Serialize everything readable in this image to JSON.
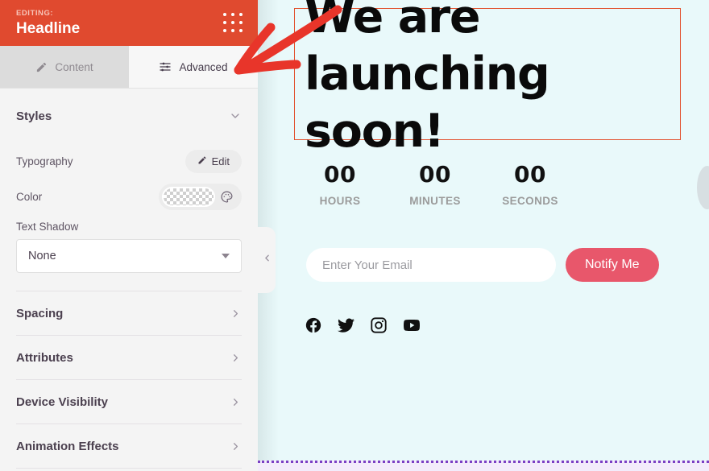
{
  "panel": {
    "header": {
      "editing_label": "EDITING:",
      "title": "Headline",
      "grid_icon": "grid-dots-icon"
    },
    "tabs": [
      {
        "label": "Content",
        "icon": "pencil-icon",
        "active": false
      },
      {
        "label": "Advanced",
        "icon": "sliders-icon",
        "active": true
      }
    ],
    "styles_section": {
      "title": "Styles",
      "chevron_icon": "chevron-down-icon",
      "typography": {
        "label": "Typography",
        "button_label": "Edit",
        "button_icon": "pencil-icon"
      },
      "color": {
        "label": "Color",
        "swatch_value": "transparent",
        "palette_icon": "palette-icon"
      },
      "text_shadow": {
        "label": "Text Shadow",
        "value": "None",
        "caret_icon": "caret-down-icon"
      }
    },
    "accordions": [
      {
        "label": "Spacing",
        "icon": "chevron-right-icon"
      },
      {
        "label": "Attributes",
        "icon": "chevron-right-icon"
      },
      {
        "label": "Device Visibility",
        "icon": "chevron-right-icon"
      },
      {
        "label": "Animation Effects",
        "icon": "chevron-right-icon"
      }
    ]
  },
  "canvas": {
    "collapse_handle_icon": "chevron-left-icon",
    "headline": {
      "line1": "We are",
      "line2": "launching soon!",
      "selection_color": "#e2502c"
    },
    "countdown": [
      {
        "value": "00",
        "label": "HOURS"
      },
      {
        "value": "00",
        "label": "MINUTES"
      },
      {
        "value": "00",
        "label": "SECONDS"
      }
    ],
    "signup": {
      "email_placeholder": "Enter Your Email",
      "email_value": "",
      "button_label": "Notify Me",
      "button_color": "#e8576b"
    },
    "socials": [
      {
        "name": "facebook-icon"
      },
      {
        "name": "twitter-icon"
      },
      {
        "name": "instagram-icon"
      },
      {
        "name": "youtube-icon"
      }
    ],
    "background_color": "#e9f9fa"
  },
  "annotation": {
    "type": "arrow",
    "color": "#e8352a",
    "points_to": "Advanced"
  }
}
